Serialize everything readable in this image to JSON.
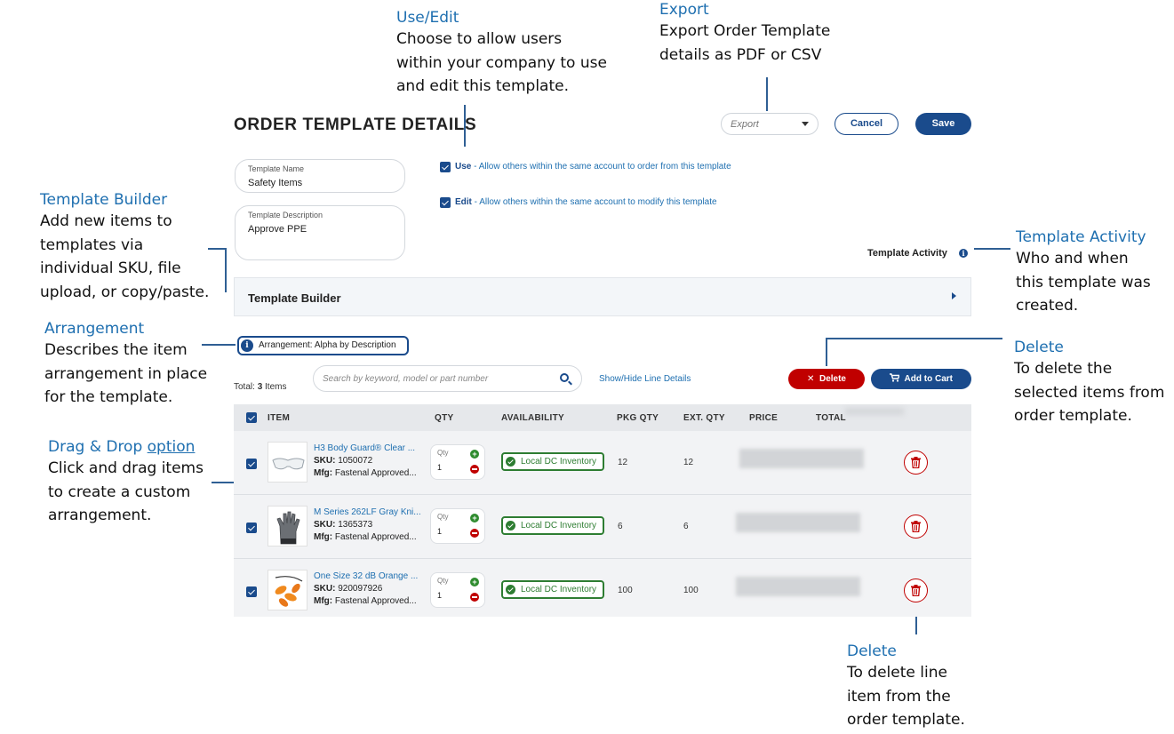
{
  "callouts": {
    "use_edit": {
      "title": "Use/Edit",
      "lines": [
        "Choose to allow users",
        "within your company to use",
        "and edit this template."
      ]
    },
    "export": {
      "title": "Export",
      "lines": [
        "Export Order Template",
        "details as PDF or CSV"
      ]
    },
    "template_builder": {
      "title": "Template Builder",
      "lines": [
        "Add new items to",
        "templates via",
        "individual SKU, file",
        "upload, or copy/paste."
      ]
    },
    "template_activity": {
      "title": "Template Activity",
      "lines": [
        "Who and when",
        "this template was",
        "created."
      ]
    },
    "arrangement": {
      "title": "Arrangement",
      "lines": [
        "Describes the item",
        "arrangement in place",
        "for the template."
      ]
    },
    "delete_selected": {
      "title": "Delete",
      "lines": [
        "To delete the",
        "selected items from",
        "order template."
      ]
    },
    "drag_drop": {
      "title_a": "Drag & Drop ",
      "title_b": "option",
      "lines": [
        "Click and drag items",
        "to create a custom",
        "arrangement."
      ]
    },
    "delete_line": {
      "title": "Delete",
      "lines": [
        "To delete line",
        "item from the",
        "order template."
      ]
    }
  },
  "header": {
    "title": "ORDER TEMPLATE DETAILS",
    "export_placeholder": "Export",
    "cancel_label": "Cancel",
    "save_label": "Save"
  },
  "form": {
    "name_label": "Template Name",
    "name_value": "Safety Items",
    "desc_label": "Template Description",
    "desc_value": "Approve PPE"
  },
  "permissions": {
    "use_label": "Use",
    "use_text": " - Allow others within the same account to order from this template",
    "edit_label": "Edit",
    "edit_text": " - Allow others within the same account to modify this template"
  },
  "activity_label": "Template Activity",
  "builder_label": "Template Builder",
  "arrangement_label": "Arrangement: Alpha by Description",
  "toolbar": {
    "total_prefix": "Total: ",
    "total_count": "3",
    "total_suffix": " Items",
    "search_placeholder": "Search by keyword, model or part number",
    "show_hide": "Show/Hide Line Details",
    "delete_label": "Delete",
    "cart_label": "Add to Cart"
  },
  "table": {
    "columns": [
      "ITEM",
      "QTY",
      "AVAILABILITY",
      "PKG QTY",
      "EXT. QTY",
      "PRICE",
      "TOTAL"
    ],
    "rows": [
      {
        "name": "H3 Body Guard® Clear ...",
        "sku_label": "SKU:",
        "sku": " 1050072",
        "mfg_label": "Mfg:",
        "mfg": " Fastenal Approved...",
        "qty_label": "Qty",
        "qty": "1",
        "availability": "Local DC Inventory",
        "pkg_qty": "12",
        "ext_qty": "12"
      },
      {
        "name": "M Series 262LF Gray Kni...",
        "sku_label": "SKU:",
        "sku": " 1365373",
        "mfg_label": "Mfg:",
        "mfg": " Fastenal Approved...",
        "qty_label": "Qty",
        "qty": "1",
        "availability": "Local DC Inventory",
        "pkg_qty": "6",
        "ext_qty": "6"
      },
      {
        "name": "One Size 32 dB Orange ...",
        "sku_label": "SKU:",
        "sku": " 920097926",
        "mfg_label": "Mfg:",
        "mfg": " Fastenal Approved...",
        "qty_label": "Qty",
        "qty": "1",
        "availability": "Local DC Inventory",
        "pkg_qty": "100",
        "ext_qty": "100"
      }
    ]
  },
  "colors": {
    "brand_blue": "#1a4b8c",
    "link_blue": "#1e6fb0",
    "delete_red": "#c00000",
    "available_green": "#2e7d32"
  },
  "icons": {
    "search": "search-icon",
    "cart": "cart-icon",
    "trash": "trash-icon",
    "info": "info-icon",
    "check": "checkmark-icon"
  }
}
